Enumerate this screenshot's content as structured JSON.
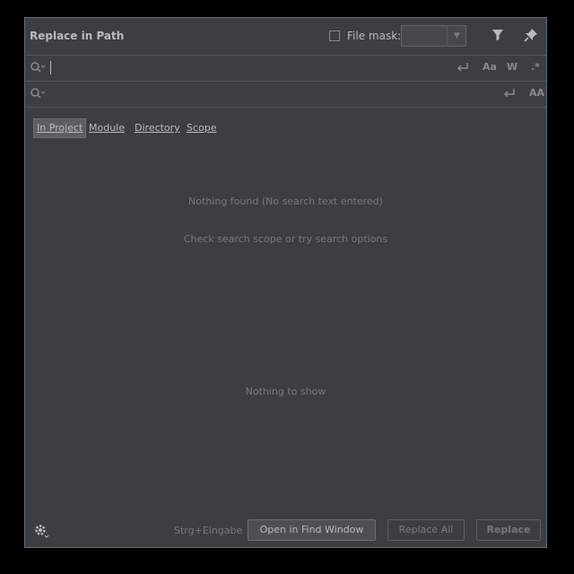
{
  "dialog": {
    "title": "Replace in Path",
    "file_mask_label": "File mask:",
    "file_mask_value": "",
    "file_mask_checked": false
  },
  "search": {
    "find_value": "",
    "replace_value": "",
    "options": [
      "Aa",
      "W",
      ".*"
    ],
    "replace_options": [
      "AA"
    ]
  },
  "scopes": {
    "active": "In Project",
    "items": [
      "In Project",
      "Module",
      "Directory",
      "Scope"
    ]
  },
  "results": {
    "nothing_found": "Nothing found (No search text entered)",
    "hint": "Check search scope or try search options",
    "nothing_to_show": "Nothing to show"
  },
  "footer": {
    "shortcut": "Strg+Eingabe",
    "open_in_find_window": "Open in Find Window",
    "replace_all": "Replace All",
    "replace": "Replace"
  },
  "icons": {
    "filter": "filter-icon",
    "pin": "pin-icon",
    "search": "search-icon",
    "regex": "regex-icon",
    "newline": "newline-icon",
    "settings": "gear-icon"
  }
}
